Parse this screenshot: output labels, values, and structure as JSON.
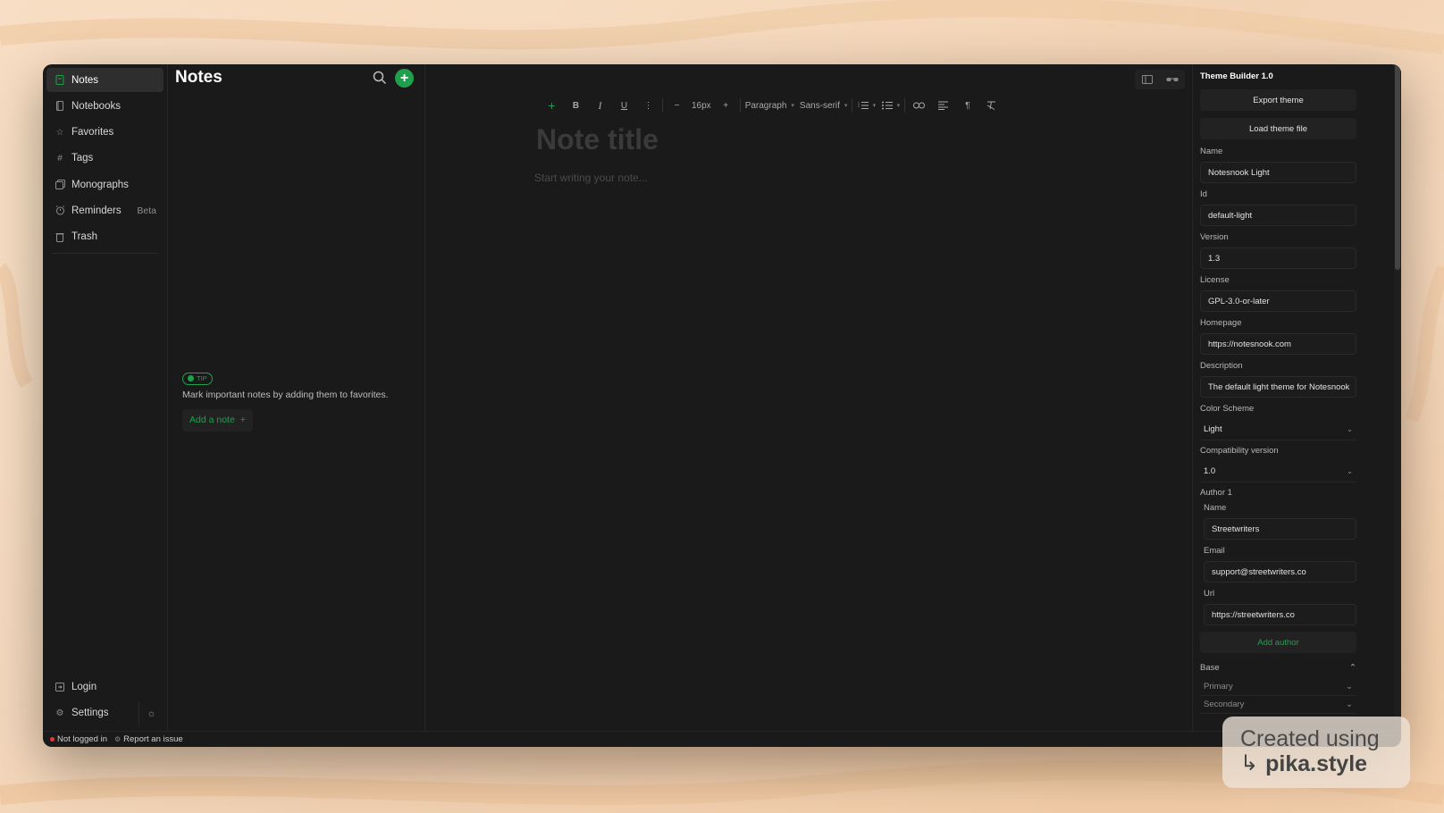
{
  "sidebar": {
    "items": [
      {
        "label": "Notes",
        "icon": "note-icon",
        "active": true
      },
      {
        "label": "Notebooks",
        "icon": "notebook-icon"
      },
      {
        "label": "Favorites",
        "icon": "star-icon"
      },
      {
        "label": "Tags",
        "icon": "hash-icon"
      },
      {
        "label": "Monographs",
        "icon": "monograph-icon"
      },
      {
        "label": "Reminders",
        "icon": "alarm-icon",
        "badge": "Beta"
      },
      {
        "label": "Trash",
        "icon": "trash-icon"
      }
    ],
    "login": "Login",
    "settings": "Settings"
  },
  "list": {
    "title": "Notes",
    "tip_badge": "TIP",
    "tip_text": "Mark important notes by adding them to favorites.",
    "add_note": "Add a note"
  },
  "toolbar": {
    "font_size": "16px",
    "block_type": "Paragraph",
    "font_family": "Sans-serif"
  },
  "editor": {
    "title_placeholder": "Note title",
    "body_placeholder": "Start writing your note..."
  },
  "builder": {
    "title": "Theme Builder 1.0",
    "export": "Export theme",
    "load": "Load theme file",
    "fields": {
      "name_label": "Name",
      "name_value": "Notesnook Light",
      "id_label": "Id",
      "id_value": "default-light",
      "version_label": "Version",
      "version_value": "1.3",
      "license_label": "License",
      "license_value": "GPL-3.0-or-later",
      "homepage_label": "Homepage",
      "homepage_value": "https://notesnook.com",
      "description_label": "Description",
      "description_value": "The default light theme for Notesnook"
    },
    "color_scheme_label": "Color Scheme",
    "color_scheme_value": "Light",
    "compat_label": "Compatibility version",
    "compat_value": "1.0",
    "author": {
      "heading": "Author 1",
      "name_label": "Name",
      "name_value": "Streetwriters",
      "email_label": "Email",
      "email_value": "support@streetwriters.co",
      "url_label": "Url",
      "url_value": "https://streetwriters.co"
    },
    "add_author": "Add author",
    "base_label": "Base",
    "primary_label": "Primary",
    "secondary_label": "Secondary"
  },
  "status": {
    "login_state": "Not logged in",
    "report": "Report an issue"
  },
  "watermark": {
    "line1": "Created using",
    "line2": "pika.style"
  },
  "colors": {
    "accent": "#1fa04c",
    "window_bg": "#1a1a1a",
    "status_dot": "#e53935"
  }
}
